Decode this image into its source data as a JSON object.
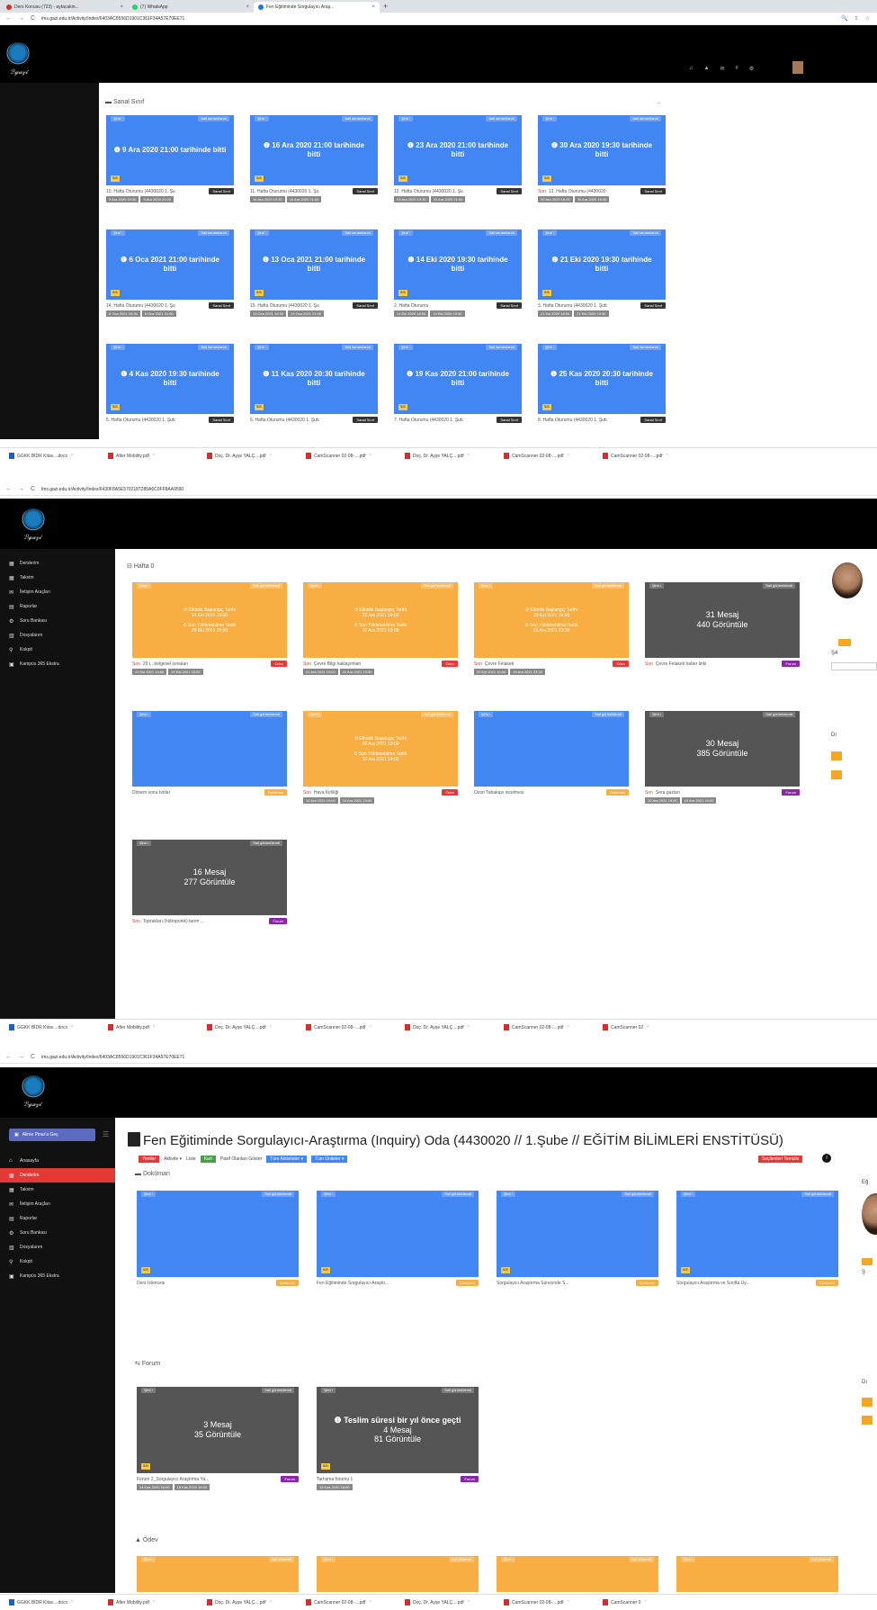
{
  "s1": {
    "tabs": [
      {
        "label": "Ders Konusu (723) - aytacakin...",
        "icon_color": "#d93025"
      },
      {
        "label": "(7) WhatsApp",
        "icon_color": "#25d366"
      },
      {
        "label": "Fen Eğitiminde Sorgulayıcı Araş...",
        "icon_color": "#1a73e8"
      }
    ],
    "url": "lms.gazi.edu.tr/Activity/Index/6403AC8556D1901C361F34A57E70EE71",
    "section_title": "Sanal Sınıf",
    "cards": [
      {
        "status": "9 Ara 2020 21:00 tarihinde bitti",
        "caption": "10. Hafta Oturumu (4430020 1. Şu",
        "d1": "9 Ara 2020 19:30",
        "d2": "9 Ara 2020 21:00",
        "red": ""
      },
      {
        "status": "16 Ara 2020 21:00 tarihinde bitti",
        "caption": "11. Hafta Oturumu (4430020 1. Şu",
        "d1": "16 Ara 2020 19:30",
        "d2": "16 Ara 2020 21:00",
        "red": ""
      },
      {
        "status": "23 Ara 2020 21:00 tarihinde bitti",
        "caption": "12. Hafta Oturumu (4430020 1. Şu",
        "d1": "23 Ara 2020 19:30",
        "d2": "23 Ara 2020 21:00",
        "red": ""
      },
      {
        "status": "30 Ara 2020 19:30 tarihinde bitti",
        "caption": "13. Hafta Oturumu (4430020",
        "d1": "30 Ara 2020 18:00",
        "d2": "30 Ara 2020 19:30",
        "red": "Son"
      },
      {
        "status": "6 Oca 2021 21:00 tarihinde bitti",
        "caption": "14. Hafta Oturumu (4430020 1. Şu",
        "d1": "6 Oca 2021 19:30",
        "d2": "6 Oca 2021 21:00",
        "red": ""
      },
      {
        "status": "13 Oca 2021 21:00 tarihinde bitti",
        "caption": "15. Hafta Oturumu (4430020 1. Şu",
        "d1": "13 Oca 2021 19:30",
        "d2": "13 Oca 2021 21:00",
        "red": ""
      },
      {
        "status": "14 Eki 2020 19:30 tarihinde bitti",
        "caption": "2. Hafta Oturumu",
        "d1": "14 Eki 2020 18:00",
        "d2": "14 Eki 2020 19:30",
        "red": ""
      },
      {
        "status": "21 Eki 2020 19:30 tarihinde bitti",
        "caption": "3. Hafta Oturumu (4430020 1. Şub",
        "d1": "21 Eki 2020 18:00",
        "d2": "21 Eki 2020 19:30",
        "red": ""
      },
      {
        "status": "4 Kas 2020 19:30 tarihinde bitti",
        "caption": "5. Hafta Oturumu (4430020 1. Şub",
        "d1": "",
        "d2": "",
        "red": ""
      },
      {
        "status": "11 Kas 2020 20:30 tarihinde bitti",
        "caption": "6. Hafta Oturumu (4430020 1. Şub",
        "d1": "",
        "d2": "",
        "red": ""
      },
      {
        "status": "19 Kas 2020 21:00 tarihinde bitti",
        "caption": "7. Hafta Oturumu (4430020 1. Şub",
        "d1": "",
        "d2": "",
        "red": ""
      },
      {
        "status": "25 Kas 2020 20:30 tarihinde bitti",
        "caption": "8. Hafta Oturumu (4430020 1. Şub",
        "d1": "",
        "d2": "",
        "red": ""
      }
    ],
    "card_top_left": "Şimi ›",
    "card_top_right": "Sali tamamlandı",
    "card_badge": "5/8",
    "type_badge": "Sanal Sınıf",
    "downloads": [
      "GGKK BİDR Kitav....docx",
      "After Mobility.pdf",
      "Doç. Dr. Ayşe YALÇ....pdf",
      "CamScanner 02-08-....pdf",
      "Doç. Dr. Ayşe YALÇ....pdf",
      "CamScanner 02-08-....pdf",
      "CamScanner 02-08-....pdf"
    ]
  },
  "s2": {
    "url": "lms.gazi.edu.tr/Activity/Index/6430F8A5E5702187285A6C0FF8AA9590",
    "menu": [
      "Derslerim",
      "Takvim",
      "İletişim Araçları",
      "Raporlar",
      "Soru Bankası",
      "Dosyalarım",
      "Kokpit",
      "Kampüs 365 Ekstra"
    ],
    "section_title": "Hafta 0",
    "orange_lines": [
      "Etkinlik Başlangıç Tarihi",
      "Son Yüklenebilme Tarihi"
    ],
    "cards": [
      {
        "kind": "orange",
        "d_start": "14 Eki 2021 19:00",
        "d_end": "29 Eki 2021 15:00",
        "caption": "29 L. belgesel sonuları",
        "red": "Son",
        "type": "Ödev",
        "b1": "22 Eki 2021 14:06",
        "b2": "29 Eki 2021 15:00"
      },
      {
        "kind": "orange",
        "d_start": "21 Ara 2021 19:00",
        "d_end": "10 Ara 2021 19:00",
        "caption": "Çevre Bilgi haklaşımları",
        "red": "Son",
        "type": "Ödev",
        "b1": "21 Ara 2021 19:00",
        "b2": "10 Ara 2021 19:00"
      },
      {
        "kind": "orange",
        "d_start": "20 Eyl 2021 19:00",
        "d_end": "19 Ara 2021 23:30",
        "caption": "Çevre Felaketi",
        "red": "Son",
        "type": "Ödev",
        "b1": "29 Eyl 2021 10:00",
        "b2": "19 Ara 2021 23:30"
      },
      {
        "kind": "dark",
        "msg": "31 Mesaj",
        "views": "440 Görüntüle",
        "caption": "Çevre Felaketi haber linki",
        "red": "Son",
        "type": "Forum",
        "b1": "",
        "b2": ""
      },
      {
        "kind": "blue",
        "caption": "Dönem sonu notlar",
        "red": "",
        "type": "Doküman",
        "b1": "",
        "b2": ""
      },
      {
        "kind": "orange",
        "d_start": "20 Ara 2021 19:00",
        "d_end": "10 Ara 2021 19:00",
        "caption": "Hava Kirliliği",
        "red": "Son",
        "type": "Ödev",
        "b1": "10 Ara 2021 19:00",
        "b2": "10 Ara 2021 19:00"
      },
      {
        "kind": "blue",
        "caption": "Ozon Tabakası incelmesi",
        "red": "",
        "type": "Doküman",
        "b1": "",
        "b2": ""
      },
      {
        "kind": "dark",
        "msg": "30 Mesaj",
        "views": "385 Görüntüle",
        "caption": "Sera gazları",
        "red": "Son",
        "type": "Forum",
        "b1": "10 Ara 2021 19:00",
        "b2": "10 Ara 2021 19:00"
      },
      {
        "kind": "dark",
        "msg": "16 Mesaj",
        "views": "277 Görüntüle",
        "caption": "Toprakları (hidroponik) tarım ...",
        "red": "Son",
        "type": "Forum",
        "b1": "",
        "b2": ""
      }
    ],
    "card_top_left": "Şimi ›",
    "card_top_right": "Sali görüntülendi",
    "right_text": "Ş4",
    "right_text2": "Dı",
    "downloads": [
      "GGKK BİDR Kitav....docx",
      "After Mobility.pdf",
      "Doç. Dr. Ayşe YALÇ....pdf",
      "CamScanner 02-08-....pdf",
      "Doç. Dr. Ayşe YALÇ....pdf",
      "CamScanner 02-08-....pdf",
      "CamScanner 02"
    ]
  },
  "s3": {
    "url": "lms.gazi.edu.tr/Activity/Index/6403AC8556D1901C361F34A57E70EE71",
    "user": "Alime Pinar'a Geç",
    "menu": [
      "Anasayfa",
      "Derslerim",
      "Takvim",
      "İletişim Araçları",
      "Raporlar",
      "Soru Bankası",
      "Dosyalarım",
      "Kokpit",
      "Kampüs 365 Ekstra"
    ],
    "title": "Fen Eğitiminde Sorgulayıcı-Araştırma (Inquiry) Oda (4430020 // 1.Şube // EĞİTİM BİLİMLERİ ENSTİTÜSÜ)",
    "filters": {
      "yeniler": "Yeniler",
      "aktivite": "Aktivite ▾",
      "liste": "Liste",
      "kart": "Kart",
      "pasif": "Pasif Olanları Göster",
      "tum_aktivite": "Tüm Aktiviteler ▾",
      "tum_uniteler": "Tüm Üniteler ▾",
      "secilenleri": "Seçilenleri Temizle"
    },
    "doc_title": "Doküman",
    "docs": [
      {
        "caption": "Ders İzlencesi"
      },
      {
        "caption": "Fen Eğitiminde Sorgulayıcı-Araştır..."
      },
      {
        "caption": "Sorgulayıcı Araştırma Sürecinde S..."
      },
      {
        "caption": "Sorgulayıcı Araştırma ve Sınıfta Uy..."
      }
    ],
    "forum_title": "Forum",
    "forums": [
      {
        "status": "",
        "msg": "3 Mesaj",
        "views": "35 Görüntüle",
        "caption": "Forum 2_Sorgulayıcı Araştırma Ya...",
        "b1": "14 Kas 2020 18:00",
        "b2": "18 Kas 2020 18:00"
      },
      {
        "status": "Teslim süresi bir yıl önce geçti",
        "msg": "4 Mesaj",
        "views": "81 Görüntüle",
        "caption": "Tartışma forumu 1",
        "b1": "15 Kas 2020 18:00",
        "b2": ""
      }
    ],
    "odev_title": "Ödev",
    "card_top_left": "Şimi ›",
    "card_top_right": "Sali görüntülendi",
    "doc_type": "Doküman",
    "forum_type": "Forum",
    "right_text": "Ş",
    "right_text2": "Dı",
    "right_text3": "Eğ",
    "downloads": [
      "GGKK BİDR Kitav....docx",
      "After Mobility.pdf",
      "Doç. Dr. Ayşe YALÇ....pdf",
      "CamScanner 02-08-....pdf",
      "Doç. Dr. Ayşe YALÇ....pdf",
      "CamScanner 02-08-....pdf",
      "CamScanner 0"
    ]
  },
  "colors": {
    "blue": "#4286f4",
    "orange": "#f8ae42",
    "dark": "#555555",
    "red": "#e53935",
    "purple": "#8e24aa"
  }
}
